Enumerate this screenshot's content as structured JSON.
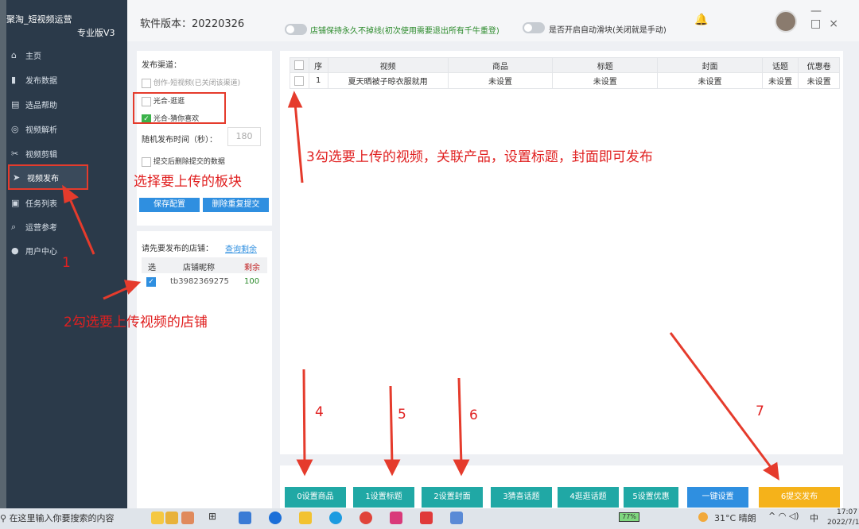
{
  "app": {
    "brand": "聚淘_短视频运营",
    "edition": "专业版V3",
    "version": "软件版本：20220326",
    "toggle1": "店铺保持永久不掉线(初次使用需要退出所有千牛重登)",
    "toggle2": "是否开启自动滑块(关闭就是手动)"
  },
  "sidebar": {
    "items": [
      {
        "label": "主页",
        "icon": "home-icon"
      },
      {
        "label": "发布数据",
        "icon": "bar-chart-icon"
      },
      {
        "label": "选品帮助",
        "icon": "document-icon"
      },
      {
        "label": "视频解析",
        "icon": "target-icon"
      },
      {
        "label": "视频剪辑",
        "icon": "scissors-icon"
      },
      {
        "label": "视频发布",
        "icon": "send-icon"
      },
      {
        "label": "任务列表",
        "icon": "calendar-icon"
      },
      {
        "label": "运营参考",
        "icon": "search-icon"
      },
      {
        "label": "用户中心",
        "icon": "user-icon"
      }
    ]
  },
  "channels": {
    "title": "发布渠道：",
    "items": [
      "创作-短视频(已关闭该渠道)",
      "光合-逛逛",
      "光合-猜你喜欢"
    ],
    "interval_label": "随机发布时间（秒）：",
    "interval_value": "180",
    "delete_label": "提交后删除提交的数据",
    "save": "保存配置",
    "delete_resubmit": "删除重复提交"
  },
  "shop": {
    "title": "请先要发布的店铺：",
    "query": "查询剩余",
    "headers": [
      "选",
      "店铺昵称",
      "剩余"
    ],
    "rows": [
      {
        "name": "tb3982369275",
        "remain": "100"
      }
    ]
  },
  "table": {
    "headers": [
      "序",
      "视频",
      "商品",
      "标题",
      "封面",
      "话题",
      "优惠卷"
    ],
    "rows": [
      {
        "no": "1",
        "video": "夏天晒被子晾衣服就用",
        "product": "未设置",
        "title": "未设置",
        "cover": "未设置",
        "topic": "未设置",
        "coupon": "未设置"
      }
    ]
  },
  "buttons": [
    "0设置商品",
    "1设置标题",
    "2设置封面",
    "3猜喜话题",
    "4逛逛话题",
    "5设置优惠",
    "一键设置",
    "6提交发布"
  ],
  "annotations": {
    "a1": "1",
    "a2": "2勾选要上传视频的店铺",
    "a3": "3勾选要上传的视频，关联产品，设置标题，封面即可发布",
    "a_sel": "选择要上传的板块",
    "n4": "4",
    "n5": "5",
    "n6": "6",
    "n7": "7"
  },
  "taskbar": {
    "search": "在这里输入你要搜索的内容",
    "battery": "77%",
    "weather": "31°C 晴朗",
    "ime": "中",
    "time": "17:07",
    "date": "2022/7/1"
  },
  "colors": {
    "sidebar": "#2b3a4a",
    "accent": "#2f8fe0",
    "submit": "#f5b21a",
    "teal": "#20a8a5",
    "annotation": "#e02020"
  }
}
